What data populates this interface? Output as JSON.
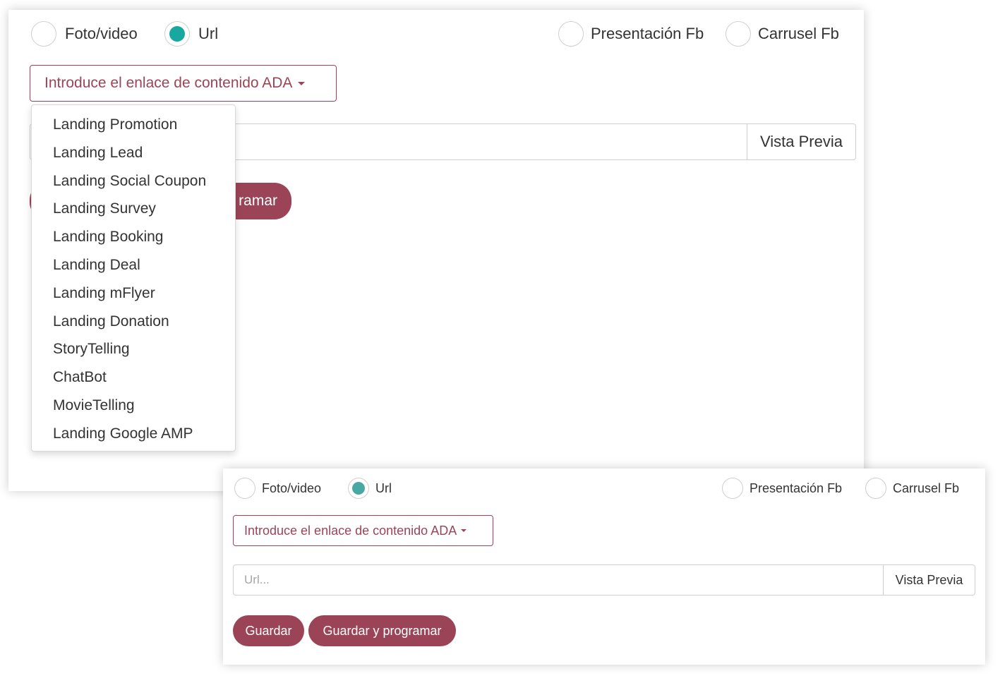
{
  "colors": {
    "accent": "#9b4457",
    "radio_selected_top": "#17a89f",
    "radio_selected_bottom": "#4aa8a2"
  },
  "icons": {
    "dropdown_caret": "caret-down-icon"
  },
  "back_panel": {
    "media_types": [
      {
        "label": "Foto/video",
        "selected": false
      },
      {
        "label": "Url",
        "selected": true
      },
      {
        "label": "Presentación Fb",
        "selected": false
      },
      {
        "label": "Carrusel Fb",
        "selected": false
      }
    ],
    "ada_dropdown": {
      "label": "Introduce el enlace de contenido ADA",
      "open": true,
      "items": [
        "Landing Promotion",
        "Landing Lead",
        "Landing Social Coupon",
        "Landing Survey",
        "Landing Booking",
        "Landing Deal",
        "Landing mFlyer",
        "Landing Donation",
        "StoryTelling",
        "ChatBot",
        "MovieTelling",
        "Landing Google AMP"
      ]
    },
    "preview_button": "Vista Previa",
    "schedule_button_visible_text": "ramar"
  },
  "front_panel": {
    "media_types": [
      {
        "label": "Foto/video",
        "selected": false
      },
      {
        "label": "Url",
        "selected": true
      },
      {
        "label": "Presentación Fb",
        "selected": false
      },
      {
        "label": "Carrusel Fb",
        "selected": false
      }
    ],
    "ada_dropdown": {
      "label": "Introduce el enlace de contenido ADA"
    },
    "url_input": {
      "value": "",
      "placeholder": "Url..."
    },
    "preview_button": "Vista Previa",
    "save_button": "Guardar",
    "save_schedule_button": "Guardar y programar"
  }
}
